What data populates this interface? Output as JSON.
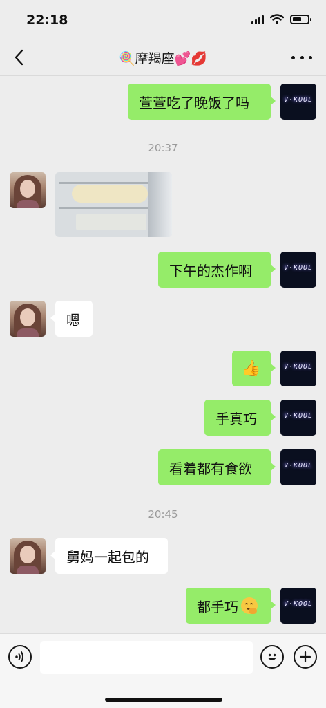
{
  "status": {
    "time": "22:18"
  },
  "nav": {
    "title": "🍭摩羯座💕💋"
  },
  "messages": {
    "m1": "萱萱吃了晚饭了吗",
    "time1": "20:37",
    "m3": "下午的杰作啊",
    "m4": "嗯",
    "m5": "👍",
    "m6": "手真巧",
    "m7": "看着都有食欲",
    "time2": "20:45",
    "m8": "舅妈一起包的",
    "m9": "都手巧"
  },
  "avatar_me": {
    "logo": "V·KOOL"
  },
  "input": {
    "placeholder": ""
  },
  "colors": {
    "bubble_mine": "#95ec69",
    "bubble_theirs": "#ffffff",
    "background": "#ededed"
  },
  "icons": [
    "back-icon",
    "more-icon",
    "voice-icon",
    "emoji-icon",
    "plus-icon",
    "thumbs-up-icon",
    "smirk-emoji-icon"
  ]
}
